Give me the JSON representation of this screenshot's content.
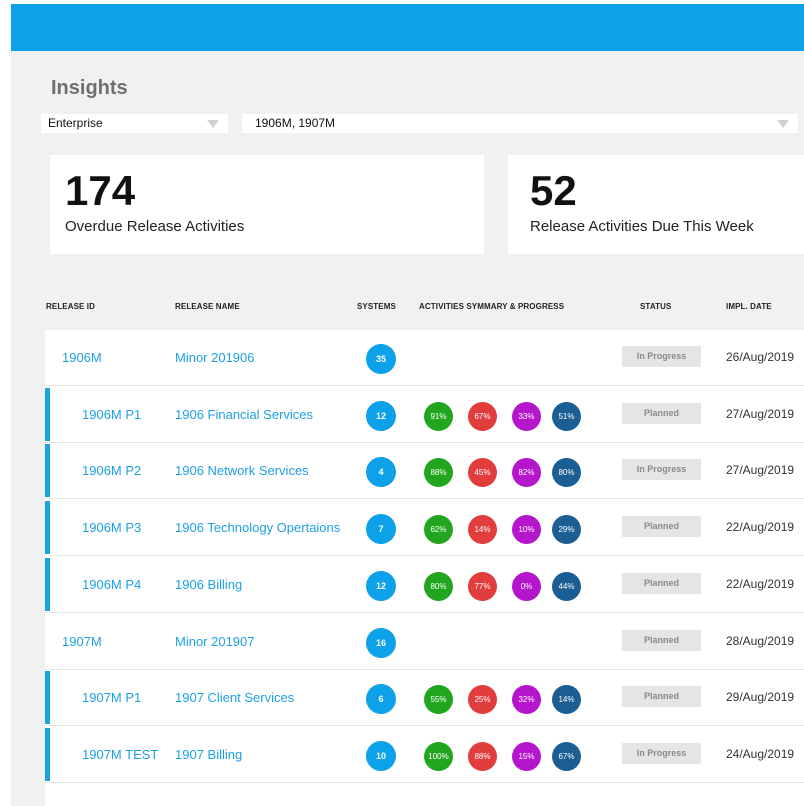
{
  "header": {
    "accent": "#0ca1e8"
  },
  "page": {
    "title": "Insights"
  },
  "filters": {
    "scope": {
      "value": "Enterprise"
    },
    "releases": {
      "value": "1906M, 1907M"
    }
  },
  "kpis": [
    {
      "value": "174",
      "label": "Overdue Release Activities"
    },
    {
      "value": "52",
      "label": "Release Activities Due This Week"
    }
  ],
  "table": {
    "columns": [
      "RELEASE ID",
      "RELEASE NAME",
      "SYSTEMS",
      "ACTIVITIES SYMMARY & PROGRESS",
      "STATUS",
      "IMPL. DATE"
    ],
    "progress_colors": [
      "#22a51f",
      "#e23d3d",
      "#b516cc",
      "#1b5e93"
    ],
    "rows": [
      {
        "id": "1906M",
        "name": "Minor 201906",
        "systems": "35",
        "progress": [],
        "status": "In Progress",
        "date": "26/Aug/2019",
        "child": false
      },
      {
        "id": "1906M P1",
        "name": "1906 Financial Services",
        "systems": "12",
        "progress": [
          "91%",
          "67%",
          "33%",
          "51%"
        ],
        "status": "Planned",
        "date": "27/Aug/2019",
        "child": true
      },
      {
        "id": "1906M P2",
        "name": "1906 Network Services",
        "systems": "4",
        "progress": [
          "88%",
          "45%",
          "82%",
          "80%"
        ],
        "status": "In Progress",
        "date": "27/Aug/2019",
        "child": true
      },
      {
        "id": "1906M P3",
        "name": "1906 Technology Opertaions",
        "systems": "7",
        "progress": [
          "62%",
          "14%",
          "10%",
          "29%"
        ],
        "status": "Planned",
        "date": "22/Aug/2019",
        "child": true
      },
      {
        "id": "1906M P4",
        "name": "1906 Billing",
        "systems": "12",
        "progress": [
          "80%",
          "77%",
          "0%",
          "44%"
        ],
        "status": "Planned",
        "date": "22/Aug/2019",
        "child": true
      },
      {
        "id": "1907M",
        "name": "Minor 201907",
        "systems": "16",
        "progress": [],
        "status": "Planned",
        "date": "28/Aug/2019",
        "child": false
      },
      {
        "id": "1907M P1",
        "name": "1907 Client Services",
        "systems": "6",
        "progress": [
          "55%",
          "25%",
          "32%",
          "14%"
        ],
        "status": "Planned",
        "date": "29/Aug/2019",
        "child": true
      },
      {
        "id": "1907M TEST",
        "name": "1907 Billing",
        "systems": "10",
        "progress": [
          "100%",
          "88%",
          "15%",
          "67%"
        ],
        "status": "In Progress",
        "date": "24/Aug/2019",
        "child": true
      }
    ]
  }
}
